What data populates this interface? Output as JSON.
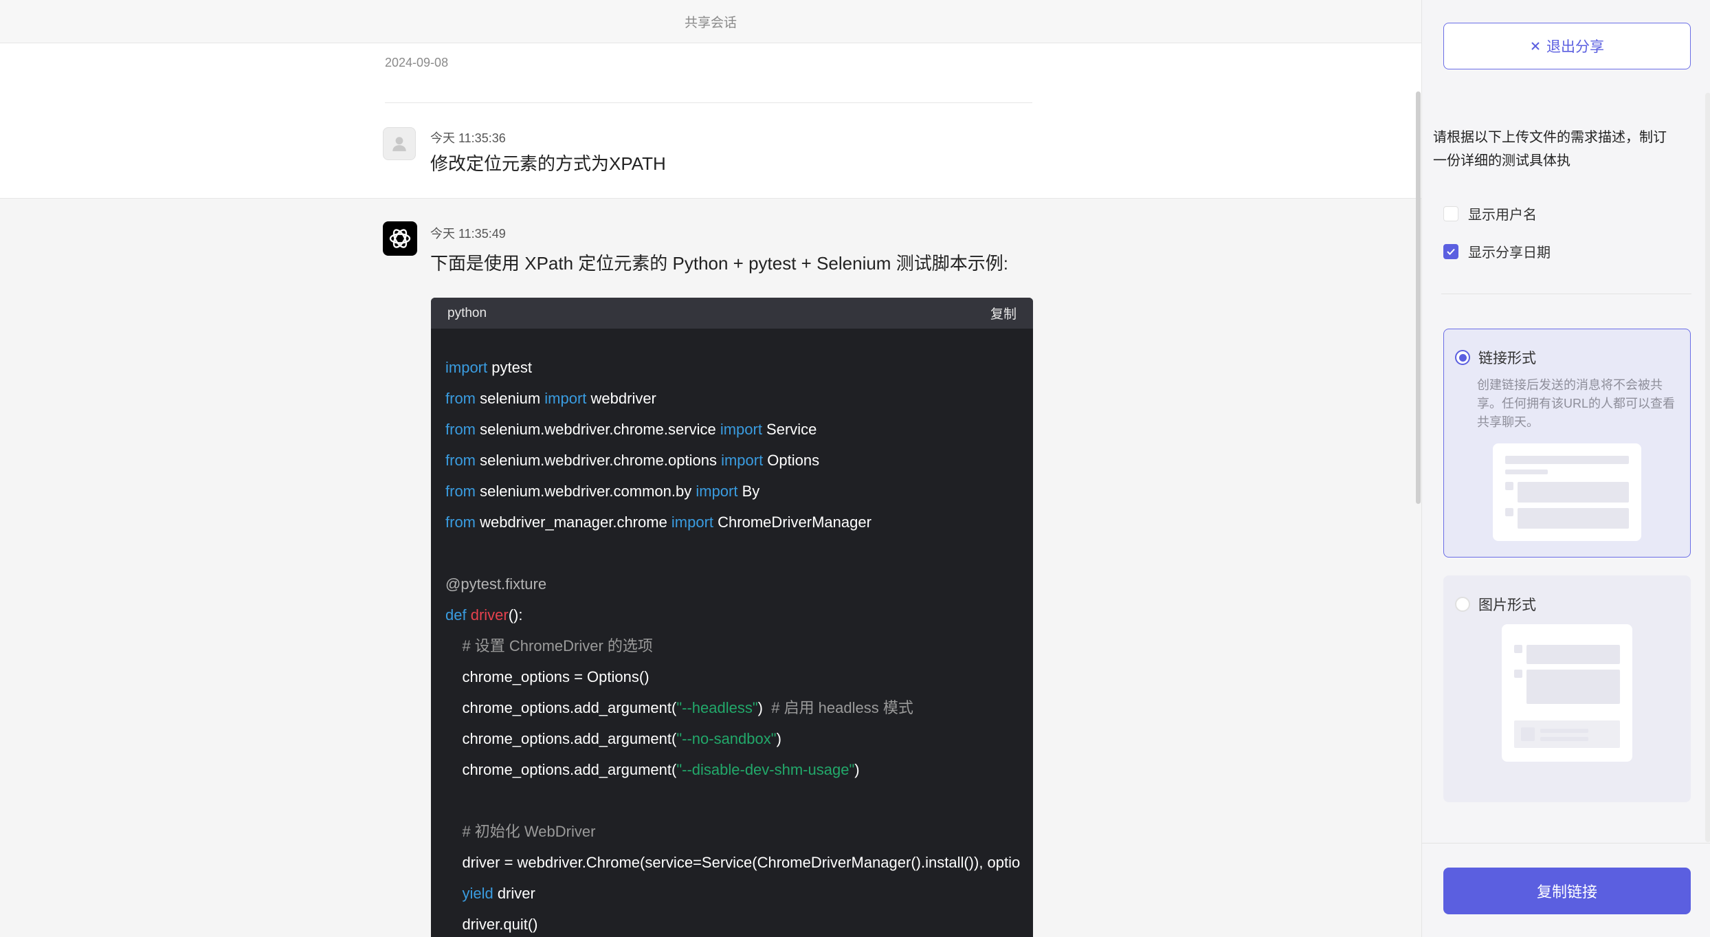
{
  "header": {
    "title": "共享会话"
  },
  "conversation": {
    "date": "2024-09-08",
    "user_message": {
      "time": "今天 11:35:36",
      "text": "修改定位元素的方式为XPATH"
    },
    "bot_message": {
      "time": "今天 11:35:49",
      "text": "下面是使用 XPath 定位元素的 Python + pytest + Selenium 测试脚本示例:",
      "code": {
        "language": "python",
        "copy_label": "复制",
        "lines": [
          [
            {
              "t": "import",
              "c": "kw"
            },
            {
              "t": " pytest",
              "c": ""
            }
          ],
          [
            {
              "t": "from",
              "c": "kw"
            },
            {
              "t": " selenium ",
              "c": ""
            },
            {
              "t": "import",
              "c": "kw"
            },
            {
              "t": " webdriver",
              "c": ""
            }
          ],
          [
            {
              "t": "from",
              "c": "kw"
            },
            {
              "t": " selenium.webdriver.chrome.service ",
              "c": ""
            },
            {
              "t": "import",
              "c": "kw"
            },
            {
              "t": " Service",
              "c": ""
            }
          ],
          [
            {
              "t": "from",
              "c": "kw"
            },
            {
              "t": " selenium.webdriver.chrome.options ",
              "c": ""
            },
            {
              "t": "import",
              "c": "kw"
            },
            {
              "t": " Options",
              "c": ""
            }
          ],
          [
            {
              "t": "from",
              "c": "kw"
            },
            {
              "t": " selenium.webdriver.common.by ",
              "c": ""
            },
            {
              "t": "import",
              "c": "kw"
            },
            {
              "t": " By",
              "c": ""
            }
          ],
          [
            {
              "t": "from",
              "c": "kw"
            },
            {
              "t": " webdriver_manager.chrome ",
              "c": ""
            },
            {
              "t": "import",
              "c": "kw"
            },
            {
              "t": " ChromeDriverManager",
              "c": ""
            }
          ],
          [],
          [
            {
              "t": "@pytest.fixture",
              "c": "dec"
            }
          ],
          [
            {
              "t": "def",
              "c": "kw"
            },
            {
              "t": " ",
              "c": ""
            },
            {
              "t": "driver",
              "c": "fn"
            },
            {
              "t": "():",
              "c": ""
            }
          ],
          [
            {
              "t": "    # 设置 ChromeDriver 的选项",
              "c": "cm"
            }
          ],
          [
            {
              "t": "    chrome_options = Options()",
              "c": ""
            }
          ],
          [
            {
              "t": "    chrome_options.add_argument(",
              "c": ""
            },
            {
              "t": "\"--headless\"",
              "c": "str"
            },
            {
              "t": ")  ",
              "c": ""
            },
            {
              "t": "# 启用 headless 模式",
              "c": "cm"
            }
          ],
          [
            {
              "t": "    chrome_options.add_argument(",
              "c": ""
            },
            {
              "t": "\"--no-sandbox\"",
              "c": "str"
            },
            {
              "t": ")",
              "c": ""
            }
          ],
          [
            {
              "t": "    chrome_options.add_argument(",
              "c": ""
            },
            {
              "t": "\"--disable-dev-shm-usage\"",
              "c": "str"
            },
            {
              "t": ")",
              "c": ""
            }
          ],
          [],
          [
            {
              "t": "    # 初始化 WebDriver",
              "c": "cm"
            }
          ],
          [
            {
              "t": "    driver = webdriver.Chrome(service=Service(ChromeDriverManager().install()), optio",
              "c": ""
            }
          ],
          [
            {
              "t": "    ",
              "c": ""
            },
            {
              "t": "yield",
              "c": "kw"
            },
            {
              "t": " driver",
              "c": ""
            }
          ],
          [
            {
              "t": "    driver.quit()",
              "c": ""
            }
          ]
        ]
      }
    }
  },
  "panel": {
    "exit_label": "退出分享",
    "preview_text": "请根据以下上传文件的需求描述，制订一份详细的测试具体执",
    "show_username_label": "显示用户名",
    "show_username_checked": false,
    "show_date_label": "显示分享日期",
    "show_date_checked": true,
    "link_option": {
      "label": "链接形式",
      "desc": "创建链接后发送的消息将不会被共享。任何拥有该URL的人都可以查看共享聊天。",
      "selected": true
    },
    "image_option": {
      "label": "图片形式",
      "selected": false
    },
    "copy_link_label": "复制链接"
  },
  "colors": {
    "accent": "#5b5fe0",
    "code_bg": "#1f2024",
    "keyword": "#3a9ce0",
    "string": "#22a86a",
    "function": "#e5414d"
  }
}
